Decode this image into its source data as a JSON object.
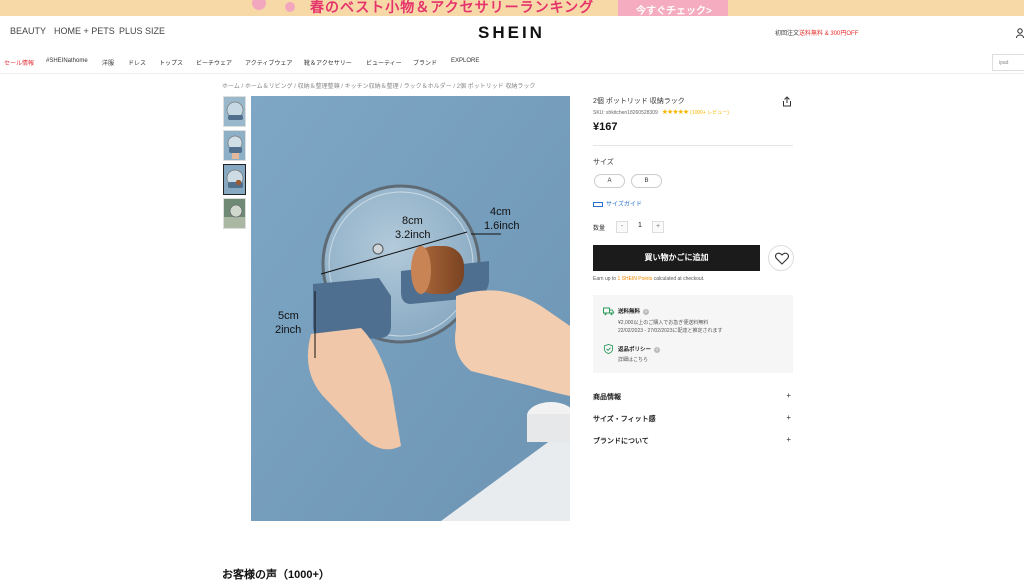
{
  "banner": {
    "text": "春のベスト小物＆アクセサリーランキング",
    "button": "今すぐチェック>"
  },
  "header": {
    "categories": [
      "BEAUTY",
      "HOME + PETS",
      "PLUS SIZE"
    ],
    "logo": "SHEIN",
    "promo_prefix": "初回注文",
    "promo_free": "送料無料",
    "promo_mid": " & ",
    "promo_off": "300円OFF"
  },
  "nav": {
    "items": [
      "セール情報",
      "#SHEINathome",
      "洋服",
      "ドレス",
      "トップス",
      "ビーチウェア",
      "アクティブウェア",
      "靴＆アクセサリー",
      "ビューティー",
      "ブランド",
      "EXPLORE"
    ],
    "search_placeholder": "ipad"
  },
  "breadcrumb": "ホーム / ホーム＆リビング / 収納＆整理整頓 / キッチン収納＆整理 / ラック＆ホルダー / 2個 ポットリッド 収納ラック",
  "image_annotations": {
    "width_cm": "8cm",
    "width_inch": "3.2inch",
    "depth_cm": "4cm",
    "depth_inch": "1.6inch",
    "height_cm": "5cm",
    "height_inch": "2inch"
  },
  "product": {
    "title": "2個 ポットリッド 収納ラック",
    "sku_label": "SKU: shkitchen18260528309",
    "stars": "★★★★★",
    "reviews": "(1000+ レビュー)",
    "price": "¥167",
    "size_label": "サイズ",
    "sizes": [
      "A",
      "B"
    ],
    "size_guide": "サイズガイド",
    "qty_label": "数量",
    "qty_minus": "-",
    "qty_value": "1",
    "qty_plus": "+",
    "add_to_cart": "買い物かごに追加",
    "points_prefix": "Earn up to ",
    "points_value": "1 SHEIN Points",
    "points_suffix": " calculated at checkout."
  },
  "shipping": {
    "title": "送料無料",
    "line1": "¥2,000以上のご購入でお急ぎ便送料無料",
    "line2": "22/02/2023 - 27/02/2023に配達と推定されます",
    "return_title": "返品ポリシー",
    "return_link": "詳細はこちら"
  },
  "accordion": [
    {
      "label": "商品情報",
      "icon": "+"
    },
    {
      "label": "サイズ・フィット感",
      "icon": "+"
    },
    {
      "label": "ブランドについて",
      "icon": "+"
    }
  ],
  "reviews_heading": "お客様の声（1000+）",
  "colors": {
    "brand": "#111111",
    "sale": "#e0303a",
    "star": "#f7b500",
    "link": "#2a6fc9"
  }
}
